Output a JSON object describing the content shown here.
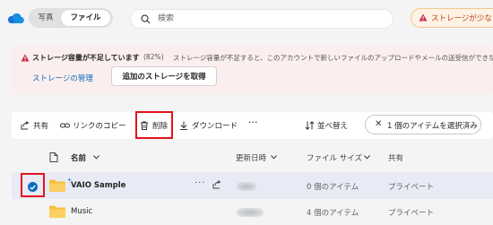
{
  "topbar": {
    "view_toggle": [
      "写真",
      "ファイル"
    ],
    "active_view": "ファイル",
    "search_placeholder": "検索",
    "storage_alert": "ストレージが少な"
  },
  "banner": {
    "title": "ストレージ容量が不足しています",
    "percent": "(82%)",
    "message": "ストレージ容量が不足すると、このアカウントで新しいファイルのアップロードやメールの送受信ができなくな",
    "manage_link": "ストレージの管理",
    "get_more_button": "追加のストレージを取得"
  },
  "commandbar": {
    "share": "共有",
    "copy_link": "リンクのコピー",
    "delete": "削除",
    "download": "ダウンロード",
    "more": "···",
    "sort": "並べ替え",
    "selection": "1 個のアイテムを選択済み"
  },
  "table": {
    "headers": {
      "name": "名前",
      "modified": "更新日時",
      "size": "ファイル サイズ",
      "sharing": "共有"
    },
    "rows": [
      {
        "name": "VAIO Sample",
        "size": "0 個のアイテム",
        "sharing": "プライベート",
        "selected": true
      },
      {
        "name": "Music",
        "size": "4 個のアイテム",
        "sharing": "プライベート",
        "selected": false
      }
    ]
  },
  "colors": {
    "accent": "#0f6cbd",
    "highlight_box": "#e3131b",
    "warning": "#c4314b",
    "folder": "#f5bf3a"
  }
}
